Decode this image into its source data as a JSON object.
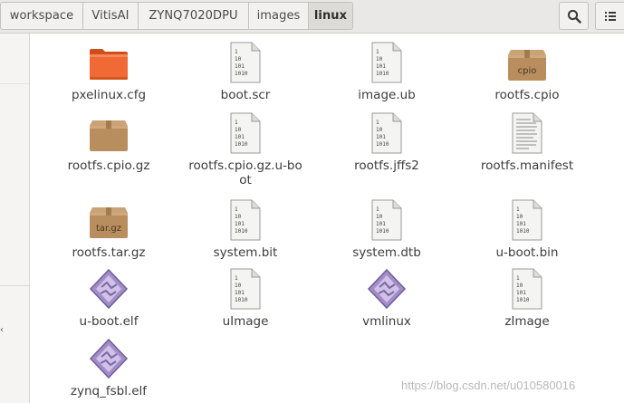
{
  "breadcrumb": [
    "workspace",
    "VitisAI",
    "ZYNQ7020DPU",
    "images",
    "linux"
  ],
  "files": [
    {
      "name": "pxelinux.cfg",
      "kind": "folder"
    },
    {
      "name": "boot.scr",
      "kind": "binary"
    },
    {
      "name": "image.ub",
      "kind": "binary"
    },
    {
      "name": "rootfs.cpio",
      "kind": "archive",
      "badge": "cpio"
    },
    {
      "name": "rootfs.cpio.gz",
      "kind": "archive",
      "badge": ""
    },
    {
      "name": "rootfs.cpio.gz.u-boot",
      "kind": "binary"
    },
    {
      "name": "rootfs.jffs2",
      "kind": "binary"
    },
    {
      "name": "rootfs.manifest",
      "kind": "text"
    },
    {
      "name": "rootfs.tar.gz",
      "kind": "archive",
      "badge": "tar.gz"
    },
    {
      "name": "system.bit",
      "kind": "binary"
    },
    {
      "name": "system.dtb",
      "kind": "binary"
    },
    {
      "name": "u-boot.bin",
      "kind": "binary"
    },
    {
      "name": "u-boot.elf",
      "kind": "executable"
    },
    {
      "name": "uImage",
      "kind": "binary"
    },
    {
      "name": "vmlinux",
      "kind": "executable"
    },
    {
      "name": "zImage",
      "kind": "binary"
    },
    {
      "name": "zynq_fsbl.elf",
      "kind": "executable"
    }
  ],
  "binary_icon_text": [
    "1",
    "10",
    "101",
    "1010"
  ],
  "watermark": "https://blog.csdn.net/u010580016",
  "colors": {
    "folder_orange": "#e8622c",
    "archive_brown": "#b38a5a",
    "executable_purple": "#9b86c2",
    "header_bg": "#e9e8e6"
  }
}
